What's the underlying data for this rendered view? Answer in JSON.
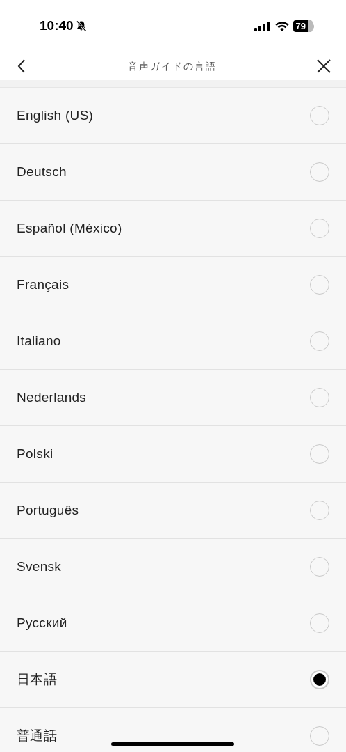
{
  "status_bar": {
    "time": "10:40",
    "silent": true,
    "battery": "79"
  },
  "header": {
    "title": "音声ガイドの言語"
  },
  "languages": [
    {
      "label": "English (US)",
      "selected": false
    },
    {
      "label": "Deutsch",
      "selected": false
    },
    {
      "label": "Español (México)",
      "selected": false
    },
    {
      "label": "Français",
      "selected": false
    },
    {
      "label": "Italiano",
      "selected": false
    },
    {
      "label": "Nederlands",
      "selected": false
    },
    {
      "label": "Polski",
      "selected": false
    },
    {
      "label": "Português",
      "selected": false
    },
    {
      "label": "Svensk",
      "selected": false
    },
    {
      "label": "Русский",
      "selected": false
    },
    {
      "label": "日本語",
      "selected": true
    },
    {
      "label": "普通話",
      "selected": false
    }
  ]
}
